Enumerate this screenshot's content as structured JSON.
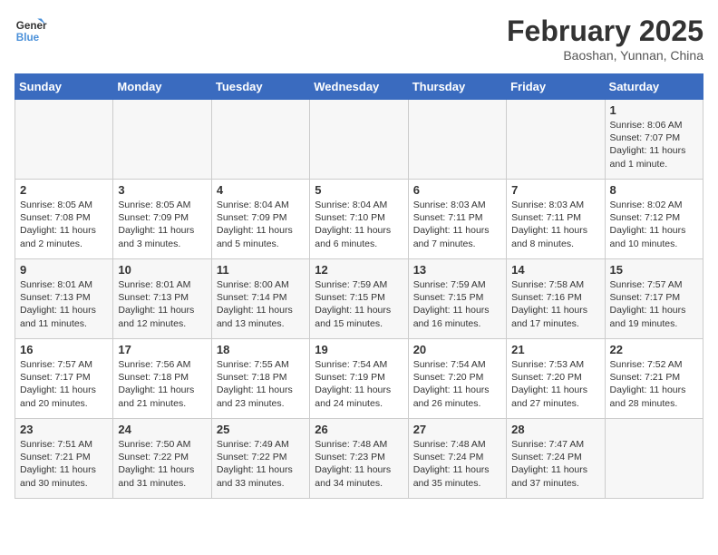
{
  "logo": {
    "line1": "General",
    "line2": "Blue"
  },
  "title": "February 2025",
  "location": "Baoshan, Yunnan, China",
  "weekdays": [
    "Sunday",
    "Monday",
    "Tuesday",
    "Wednesday",
    "Thursday",
    "Friday",
    "Saturday"
  ],
  "weeks": [
    [
      {
        "day": "",
        "info": ""
      },
      {
        "day": "",
        "info": ""
      },
      {
        "day": "",
        "info": ""
      },
      {
        "day": "",
        "info": ""
      },
      {
        "day": "",
        "info": ""
      },
      {
        "day": "",
        "info": ""
      },
      {
        "day": "1",
        "info": "Sunrise: 8:06 AM\nSunset: 7:07 PM\nDaylight: 11 hours and 1 minute."
      }
    ],
    [
      {
        "day": "2",
        "info": "Sunrise: 8:05 AM\nSunset: 7:08 PM\nDaylight: 11 hours and 2 minutes."
      },
      {
        "day": "3",
        "info": "Sunrise: 8:05 AM\nSunset: 7:09 PM\nDaylight: 11 hours and 3 minutes."
      },
      {
        "day": "4",
        "info": "Sunrise: 8:04 AM\nSunset: 7:09 PM\nDaylight: 11 hours and 5 minutes."
      },
      {
        "day": "5",
        "info": "Sunrise: 8:04 AM\nSunset: 7:10 PM\nDaylight: 11 hours and 6 minutes."
      },
      {
        "day": "6",
        "info": "Sunrise: 8:03 AM\nSunset: 7:11 PM\nDaylight: 11 hours and 7 minutes."
      },
      {
        "day": "7",
        "info": "Sunrise: 8:03 AM\nSunset: 7:11 PM\nDaylight: 11 hours and 8 minutes."
      },
      {
        "day": "8",
        "info": "Sunrise: 8:02 AM\nSunset: 7:12 PM\nDaylight: 11 hours and 10 minutes."
      }
    ],
    [
      {
        "day": "9",
        "info": "Sunrise: 8:01 AM\nSunset: 7:13 PM\nDaylight: 11 hours and 11 minutes."
      },
      {
        "day": "10",
        "info": "Sunrise: 8:01 AM\nSunset: 7:13 PM\nDaylight: 11 hours and 12 minutes."
      },
      {
        "day": "11",
        "info": "Sunrise: 8:00 AM\nSunset: 7:14 PM\nDaylight: 11 hours and 13 minutes."
      },
      {
        "day": "12",
        "info": "Sunrise: 7:59 AM\nSunset: 7:15 PM\nDaylight: 11 hours and 15 minutes."
      },
      {
        "day": "13",
        "info": "Sunrise: 7:59 AM\nSunset: 7:15 PM\nDaylight: 11 hours and 16 minutes."
      },
      {
        "day": "14",
        "info": "Sunrise: 7:58 AM\nSunset: 7:16 PM\nDaylight: 11 hours and 17 minutes."
      },
      {
        "day": "15",
        "info": "Sunrise: 7:57 AM\nSunset: 7:17 PM\nDaylight: 11 hours and 19 minutes."
      }
    ],
    [
      {
        "day": "16",
        "info": "Sunrise: 7:57 AM\nSunset: 7:17 PM\nDaylight: 11 hours and 20 minutes."
      },
      {
        "day": "17",
        "info": "Sunrise: 7:56 AM\nSunset: 7:18 PM\nDaylight: 11 hours and 21 minutes."
      },
      {
        "day": "18",
        "info": "Sunrise: 7:55 AM\nSunset: 7:18 PM\nDaylight: 11 hours and 23 minutes."
      },
      {
        "day": "19",
        "info": "Sunrise: 7:54 AM\nSunset: 7:19 PM\nDaylight: 11 hours and 24 minutes."
      },
      {
        "day": "20",
        "info": "Sunrise: 7:54 AM\nSunset: 7:20 PM\nDaylight: 11 hours and 26 minutes."
      },
      {
        "day": "21",
        "info": "Sunrise: 7:53 AM\nSunset: 7:20 PM\nDaylight: 11 hours and 27 minutes."
      },
      {
        "day": "22",
        "info": "Sunrise: 7:52 AM\nSunset: 7:21 PM\nDaylight: 11 hours and 28 minutes."
      }
    ],
    [
      {
        "day": "23",
        "info": "Sunrise: 7:51 AM\nSunset: 7:21 PM\nDaylight: 11 hours and 30 minutes."
      },
      {
        "day": "24",
        "info": "Sunrise: 7:50 AM\nSunset: 7:22 PM\nDaylight: 11 hours and 31 minutes."
      },
      {
        "day": "25",
        "info": "Sunrise: 7:49 AM\nSunset: 7:22 PM\nDaylight: 11 hours and 33 minutes."
      },
      {
        "day": "26",
        "info": "Sunrise: 7:48 AM\nSunset: 7:23 PM\nDaylight: 11 hours and 34 minutes."
      },
      {
        "day": "27",
        "info": "Sunrise: 7:48 AM\nSunset: 7:24 PM\nDaylight: 11 hours and 35 minutes."
      },
      {
        "day": "28",
        "info": "Sunrise: 7:47 AM\nSunset: 7:24 PM\nDaylight: 11 hours and 37 minutes."
      },
      {
        "day": "",
        "info": ""
      }
    ]
  ]
}
